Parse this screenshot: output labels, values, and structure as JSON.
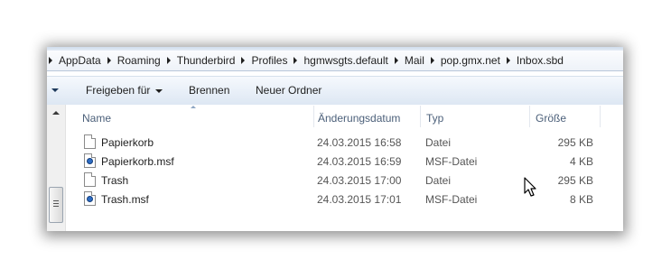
{
  "breadcrumb": [
    "AppData",
    "Roaming",
    "Thunderbird",
    "Profiles",
    "hgmwsgts.default",
    "Mail",
    "pop.gmx.net",
    "Inbox.sbd"
  ],
  "toolbar": {
    "share_label": "Freigeben für",
    "burn_label": "Brennen",
    "new_folder_label": "Neuer Ordner"
  },
  "columns": {
    "name": "Name",
    "date": "Änderungsdatum",
    "type": "Typ",
    "size": "Größe"
  },
  "files": [
    {
      "name": "Papierkorb",
      "date": "24.03.2015 16:58",
      "type": "Datei",
      "size": "295 KB",
      "icon": "file-icon"
    },
    {
      "name": "Papierkorb.msf",
      "date": "24.03.2015 16:59",
      "type": "MSF-Datei",
      "size": "4 KB",
      "icon": "msf-file-icon"
    },
    {
      "name": "Trash",
      "date": "24.03.2015 17:00",
      "type": "Datei",
      "size": "295 KB",
      "icon": "file-icon"
    },
    {
      "name": "Trash.msf",
      "date": "24.03.2015 17:01",
      "type": "MSF-Datei",
      "size": "8 KB",
      "icon": "msf-file-icon"
    }
  ]
}
